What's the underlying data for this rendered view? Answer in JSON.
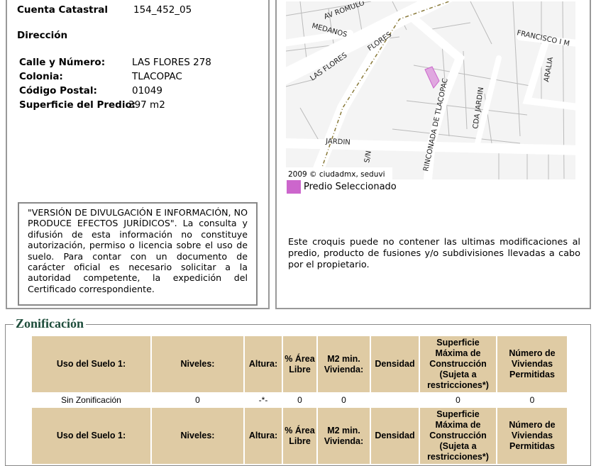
{
  "info": {
    "cuenta_label": "Cuenta Catastral",
    "cuenta_value": "154_452_05",
    "direccion_label": "Dirección",
    "rows": [
      {
        "label": "Calle y Número:",
        "value": "LAS FLORES 278"
      },
      {
        "label": "Colonia:",
        "value": "TLACOPAC"
      },
      {
        "label": "Código Postal:",
        "value": "01049"
      },
      {
        "label": "Superficie del Predio:",
        "value": "397 m2"
      }
    ]
  },
  "disclaimer": "\"VERSIÓN DE DIVULGACIÓN E INFORMACIÓN, NO PRODUCE EFECTOS JURÍDICOS\". La consulta y difusión de esta información no constituye autorización, permiso o licencia sobre el uso de suelo. Para contar con un documento de carácter oficial es necesario solicitar a la autoridad competente, la expedición del Certificado correspondiente.",
  "map": {
    "streets": [
      "AV ROMULO",
      "MEDANOS",
      "FLORES",
      "LAS FLORES",
      "FRANCISCO I M",
      "ARALIA",
      "CDA JARDIN",
      "RINCONADA DE TLACOPAC",
      "JARDIN",
      "S/N"
    ],
    "copyright": "2009 © ciudadmx, seduvi",
    "legend": "Predio Seleccionado",
    "selected_color": "#cc66cc"
  },
  "note": "Este croquis puede no contener las ultimas modificaciones al predio, producto de fusiones y/o subdivisiones llevadas a cabo por el propietario.",
  "zonificacion": {
    "title": "Zonificación",
    "header_color": "#dfcba4",
    "headers": [
      "Uso del Suelo 1:",
      "Niveles:",
      "Altura:",
      "% Área Libre",
      "M2 min. Vivienda:",
      "Densidad",
      "Superficie Máxima de Construcción (Sujeta a restricciones*)",
      "Número de Viviendas Permitidas"
    ],
    "rows": [
      [
        "Sin Zonificación",
        "0",
        "-*-",
        "0",
        "0",
        "",
        "0",
        "0"
      ]
    ]
  }
}
